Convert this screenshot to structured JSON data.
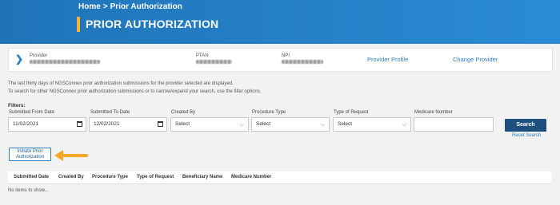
{
  "header": {
    "breadcrumb": {
      "home": "Home",
      "separator": ">",
      "current": "Prior Authorization"
    },
    "title": "PRIOR AUTHORIZATION"
  },
  "provider_card": {
    "provider_label": "Provider",
    "ptan_label": "PTAN",
    "npi_label": "NPI",
    "provider_profile_link": "Provider Profile",
    "change_provider_link": "Change Provider"
  },
  "info": {
    "line1": "The last thirty days of NGSConnex prior authorization submissions for the provider selected are displayed.",
    "line2": "To search for other NGSConnex prior authorization submissions or to narrow/expand your search, use the filter options."
  },
  "filters": {
    "heading": "Filters:",
    "submitted_from": {
      "label": "Submitted From Date",
      "value": "11/02/2021"
    },
    "submitted_to": {
      "label": "Submitted To Date",
      "value": "12/02/2021"
    },
    "created_by": {
      "label": "Created By",
      "value": "Select"
    },
    "procedure_type": {
      "label": "Procedure Type",
      "value": "Select"
    },
    "type_of_request": {
      "label": "Type of Request",
      "value": "Select"
    },
    "medicare_number": {
      "label": "Medicare Number",
      "value": ""
    },
    "search_button": "Search",
    "reset_link": "Reset Search"
  },
  "actions": {
    "initiate_line1": "Initiate Prior",
    "initiate_line2": "Authorization"
  },
  "table": {
    "columns": [
      "Submitted Date",
      "Created By",
      "Procedure Type",
      "Type of Request",
      "Beneficiary Name",
      "Medicare Number"
    ],
    "empty_message": "No items to show..."
  },
  "colors": {
    "header_blue": "#1f74b8",
    "accent_gold": "#f5b335",
    "link_blue": "#2a7fc2",
    "button_navy": "#1c4f7e"
  }
}
